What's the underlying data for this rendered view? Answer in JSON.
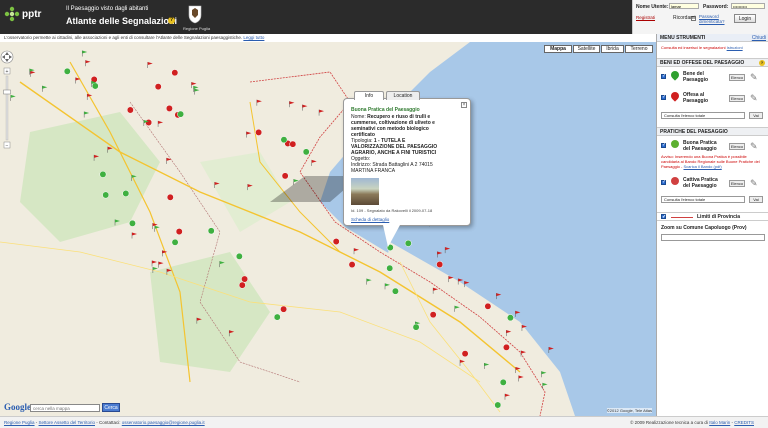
{
  "header": {
    "logo_text": "pptr",
    "subtitle": "Il Paesaggio visto dagli abitanti",
    "title": "Atlante delle Segnalazioni",
    "help_badge": "?",
    "crest_label": "Regione Puglia"
  },
  "login": {
    "user_label": "Nome Utente:",
    "user_value": "lamar",
    "password_label": "Password:",
    "password_value": "••••••••••",
    "register_link": "Registrati",
    "remember_label": "Ricordami",
    "forgot_link": "Password dimenticata?",
    "login_button": "Login"
  },
  "infobar": {
    "text": "L'osservatorio permette ai cittadini, alle associazioni e agli enti di consultare l'Atlante delle Segnalazioni paesaggistiche.",
    "link": "Leggi tutto"
  },
  "map": {
    "types": [
      "Mappa",
      "Satellite",
      "Ibrida",
      "Terreno"
    ],
    "active_type": "Mappa",
    "copyright": "©2012 Google, Tele Atlas",
    "search_placeholder": "cerca nella mappa",
    "search_button": "Cerca",
    "google_logo": "Google"
  },
  "popup": {
    "tabs": [
      "Info",
      "Location"
    ],
    "close": "×",
    "heading": "Buona Pratica del Paesaggio",
    "name_label": "Nome:",
    "name_value": "Recupero e riuso di trulli e cummerse, coltivazione di uliveto e seminativi con metodo biologico certificato",
    "type_label": "Tipologia:",
    "type_value": "1 - TUTELA E VALORIZZAZIONE DEL PAESAGGIO AGRARIO, ANCHE A FINI TURISTICI",
    "object_label": "Oggetto:",
    "address_label": "Indirizzo:",
    "address_value": "Strada Battaglini A 2 74015 MARTINA FRANCA",
    "meta": "Id. 109 - Segnalato da Rakovelli il 2009-07-18",
    "detail_link": "Scheda di dettaglio"
  },
  "panel": {
    "title": "MENU STRUMENTI",
    "close": "Chiudi",
    "hint_text": "Consulta ed inserisci le segnalazioni",
    "hint_link": "Istruzioni",
    "section1": "BENI ED OFFESE DEL PAESAGGIO",
    "section2": "PRATICHE DEL PAESAGGIO",
    "help": "?",
    "items": [
      {
        "label": "Bene del Paesaggio",
        "color": "#2fa02f"
      },
      {
        "label": "Offesa al Paesaggio",
        "color": "#d02020"
      },
      {
        "label": "Buona Pratica del Paesaggio",
        "color": "#5cb030"
      },
      {
        "label": "Cattiva Pratica del Paesaggio",
        "color": "#d04040"
      }
    ],
    "elenco": "Elenco",
    "select_value": "Consulta l'elenco totale",
    "vai": "Vai",
    "warning": "Avviso: Inserendo una Buona Pratica è possibile candidarla al Bando Regionale sulle Buone Pratiche del Paesaggio -",
    "warning_link": "Scarica il Bando (pdf)",
    "limits_label": "Limiti di Provincia",
    "zoom_label": "Zoom su Comune Capoluogo (Prov)"
  },
  "footer": {
    "left": "Regione Puglia",
    "sector": "Settore Assetto del Territorio",
    "contacts": "Contattaci:",
    "email": "osservatorio.paesaggio@regione.puglia.it",
    "right": "© 2009 Realizzazione tecnica a cura di",
    "author": "Italo Marin",
    "credits": "CREDITS"
  },
  "colors": {
    "header_bg": "#2b2b2b",
    "sea": "#a8c8e8",
    "land": "#f0ecdf",
    "pin_green": "#3fb040",
    "pin_red": "#d02020"
  }
}
